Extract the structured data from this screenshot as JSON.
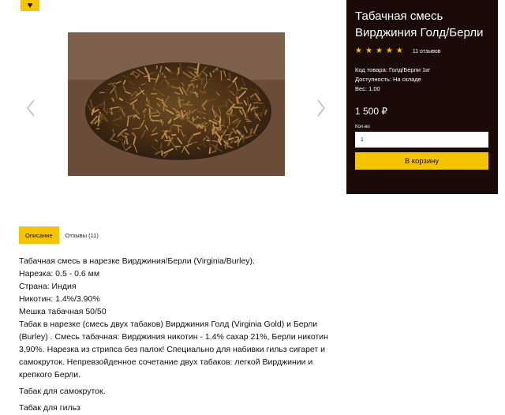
{
  "favorite": {
    "icon": "heart-icon",
    "glyph": "♥"
  },
  "gallery": {
    "prev_icon": "chevron-left-icon",
    "next_icon": "chevron-right-icon",
    "image": "tobacco-pile"
  },
  "product": {
    "title": "Табачная смесь Вирджиния Голд/Берли",
    "rating": {
      "stars": 5,
      "max": 5,
      "reviews_label": "11 отзывов"
    },
    "sku_line": "Код товара: Голд/Берли 1кг",
    "availability_line": "Доступность: На складе",
    "weight_line": "Вес: 1.00",
    "price": "1 500 ₽",
    "qty_label": "Кол-во",
    "qty_value": "1",
    "cart_button": "В корзину"
  },
  "tabs": [
    {
      "label": "Описание",
      "active": true
    },
    {
      "label": "Отзывы (11)",
      "active": false
    }
  ],
  "description": {
    "lines": [
      "Табачная смесь в нарезке Вирджиния/Берли (Virginia/Burley).",
      "Нарезка: 0.5 - 0.6 мм",
      "Страна: Индия",
      "Никотин: 1.4%/3.90%",
      "Мешка табачная 50/50"
    ],
    "paragraph": "Табак в нарезке (смесь двух табаков) Вирджиния Голд (Virginia Gold) и Берли (Burley) . Смесь табачная: Вирджиния никотин - 1.4% сахар 21%, Берли никотин 3,90%. Нарезка из стрипса без палок! Специально для набивки гильз сигарет и самокруток. Непревзойденное сочетание двух табаков: легкой Вирджинии и крепкого Берли.",
    "extra_1": "Табак для самокруток.",
    "extra_2": "Табак для гильз"
  },
  "colors": {
    "accent": "#f5c400",
    "panel_bg": "#1a0a08"
  }
}
